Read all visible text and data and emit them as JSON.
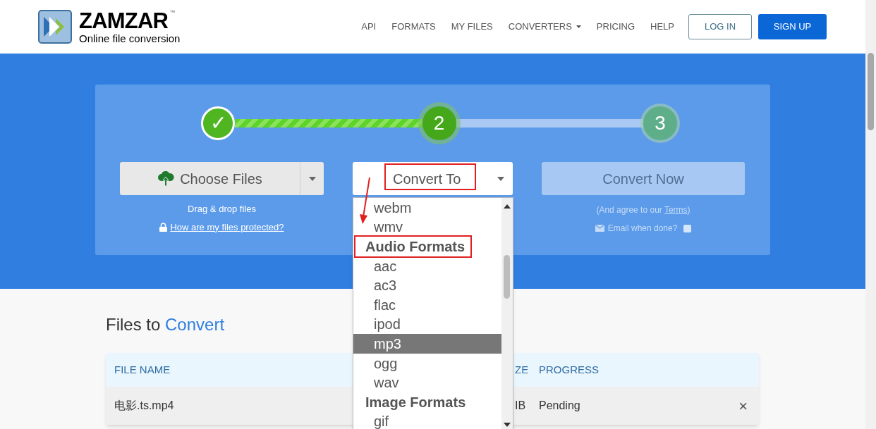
{
  "header": {
    "logo_title": "ZAMZAR",
    "logo_mark": "™",
    "logo_subtitle": "Online file conversion",
    "nav": [
      {
        "label": "API",
        "has_caret": false
      },
      {
        "label": "FORMATS",
        "has_caret": false
      },
      {
        "label": "MY FILES",
        "has_caret": false
      },
      {
        "label": "CONVERTERS",
        "has_caret": true
      },
      {
        "label": "PRICING",
        "has_caret": false
      },
      {
        "label": "HELP",
        "has_caret": false
      }
    ],
    "buttons": [
      {
        "label": "LOG IN",
        "kind": "outline"
      },
      {
        "label": "SIGN UP",
        "kind": "primary"
      }
    ]
  },
  "steps": [
    {
      "label": "✓",
      "done": true,
      "current": false
    },
    {
      "label": "2",
      "done": false,
      "current": true
    },
    {
      "label": "3",
      "done": false,
      "current": false
    }
  ],
  "choose_files": {
    "label": "Choose Files",
    "hint": "Drag & drop files",
    "link": "How are my files protected?"
  },
  "convert_to": {
    "label": "Convert To",
    "options": [
      {
        "label": "webm",
        "kind": "option",
        "selected": false
      },
      {
        "label": "wmv",
        "kind": "option",
        "selected": false
      },
      {
        "label": "Audio Formats",
        "kind": "group",
        "selected": false,
        "annotated": true
      },
      {
        "label": "aac",
        "kind": "option",
        "selected": false
      },
      {
        "label": "ac3",
        "kind": "option",
        "selected": false
      },
      {
        "label": "flac",
        "kind": "option",
        "selected": false
      },
      {
        "label": "ipod",
        "kind": "option",
        "selected": false
      },
      {
        "label": "mp3",
        "kind": "option",
        "selected": true
      },
      {
        "label": "ogg",
        "kind": "option",
        "selected": false
      },
      {
        "label": "wav",
        "kind": "option",
        "selected": false
      },
      {
        "label": "Image Formats",
        "kind": "group",
        "selected": false,
        "annotated": false
      },
      {
        "label": "gif",
        "kind": "option",
        "selected": false
      }
    ]
  },
  "convert_now": {
    "label": "Convert Now",
    "disabled": true,
    "agree_before": "(And agree to our ",
    "agree_link": "Terms",
    "agree_after": ")",
    "email_label": "Email when done?",
    "email_checked": false
  },
  "files": {
    "title_start": "Files to ",
    "title_accent": "Convert",
    "columns": [
      "FILE NAME",
      "ZE",
      "PROGRESS"
    ],
    "rows": [
      {
        "file_name": "电影.ts.mp4",
        "column_2": "IB",
        "progress": "Pending",
        "remove": "×"
      }
    ]
  }
}
